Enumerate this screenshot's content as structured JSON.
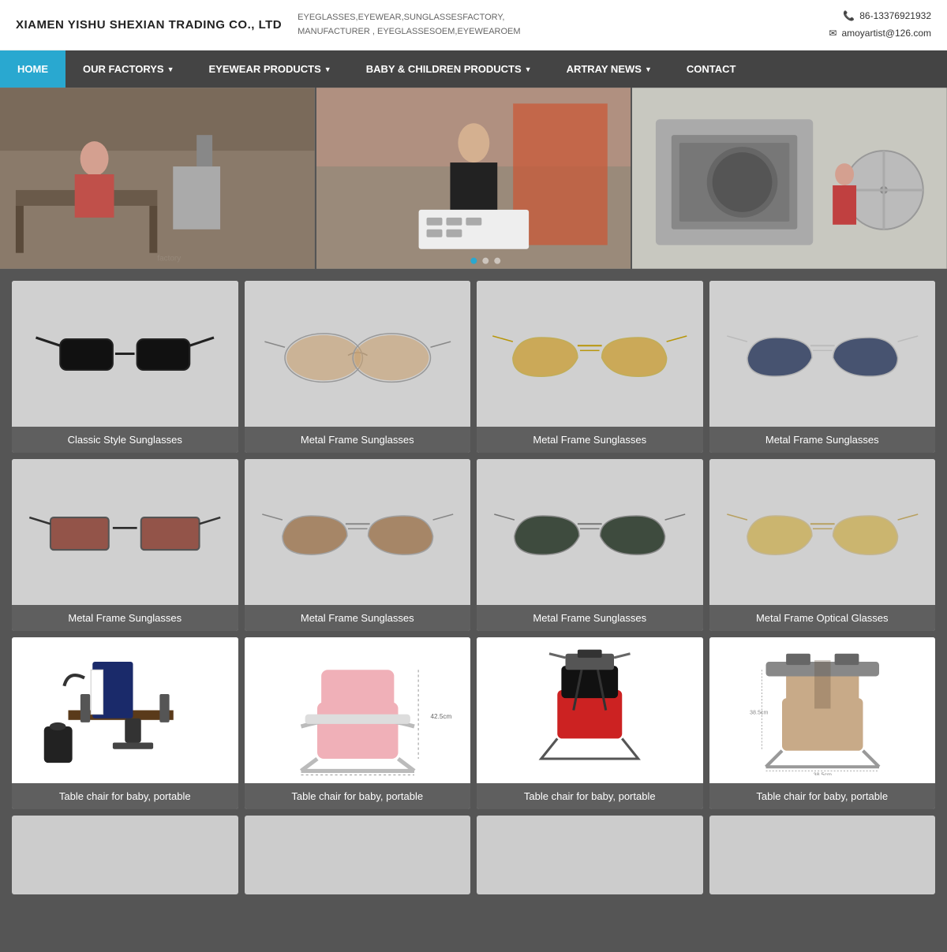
{
  "company": {
    "name": "XIAMEN YISHU SHEXIAN TRADING CO., LTD",
    "tagline_line1": "EYEGLASSES,EYEWEAR,SUNGLASSESFACTORY,",
    "tagline_line2": "MANUFACTURER , EYEGLASSESOEM,EYEWEAROEM",
    "phone": "86-13376921932",
    "email": "amoyartist@126.com"
  },
  "nav": {
    "items": [
      {
        "label": "HOME",
        "active": true,
        "has_arrow": false
      },
      {
        "label": "OUR FACTORYS",
        "active": false,
        "has_arrow": true
      },
      {
        "label": "EYEWEAR PRODUCTS",
        "active": false,
        "has_arrow": true
      },
      {
        "label": "BABY & CHILDREN PRODUCTS",
        "active": false,
        "has_arrow": true
      },
      {
        "label": "ARTRAY NEWS",
        "active": false,
        "has_arrow": true
      },
      {
        "label": "CONTACT",
        "active": false,
        "has_arrow": false
      }
    ]
  },
  "products": {
    "row1": [
      {
        "label": "Classic Style Sunglasses",
        "type": "classic"
      },
      {
        "label": "Metal Frame Sunglasses",
        "type": "metal1"
      },
      {
        "label": "Metal Frame Sunglasses",
        "type": "metal2"
      },
      {
        "label": "Metal Frame Sunglasses",
        "type": "metal3"
      }
    ],
    "row2": [
      {
        "label": "Metal Frame Sunglasses",
        "type": "metal4"
      },
      {
        "label": "Metal Frame Sunglasses",
        "type": "metal5"
      },
      {
        "label": "Metal Frame Sunglasses",
        "type": "metal6"
      },
      {
        "label": "Metal Frame Optical Glasses",
        "type": "optical"
      }
    ],
    "row3": [
      {
        "label": "Table chair for baby, portable",
        "type": "baby1"
      },
      {
        "label": "Table chair for baby, portable",
        "type": "baby2"
      },
      {
        "label": "Table chair for baby, portable",
        "type": "baby3"
      },
      {
        "label": "Table chair for baby, portable",
        "type": "baby4"
      }
    ]
  }
}
